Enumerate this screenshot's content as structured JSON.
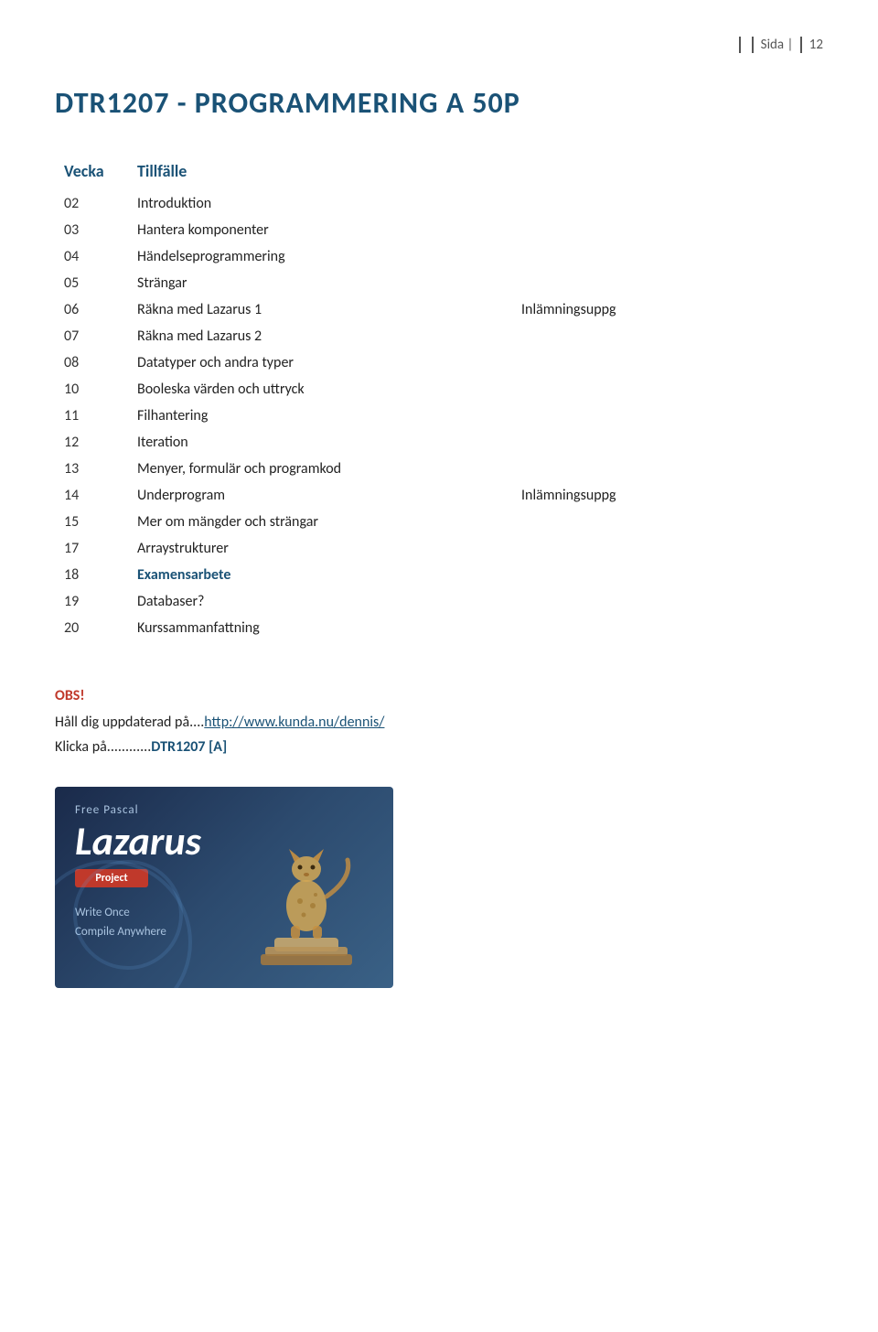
{
  "header": {
    "label": "Sida",
    "page_number": "12"
  },
  "title": "DTR1207 - PROGRAMMERING A 50P",
  "table": {
    "col_week": "Vecka",
    "col_event": "Tillfälle",
    "col_note": "",
    "rows": [
      {
        "week": "02",
        "event": "Introduktion",
        "note": "",
        "bold": false
      },
      {
        "week": "03",
        "event": "Hantera komponenter",
        "note": "",
        "bold": false
      },
      {
        "week": "04",
        "event": "Händelseprogrammering",
        "note": "",
        "bold": false
      },
      {
        "week": "05",
        "event": "Strängar",
        "note": "",
        "bold": false
      },
      {
        "week": "06",
        "event": "Räkna med Lazarus 1",
        "note": "Inlämningsuppg",
        "bold": false
      },
      {
        "week": "07",
        "event": "Räkna med Lazarus 2",
        "note": "",
        "bold": false
      },
      {
        "week": "08",
        "event": "Datatyper och andra typer",
        "note": "",
        "bold": false
      },
      {
        "week": "10",
        "event": "Booleska värden och uttryck",
        "note": "",
        "bold": false
      },
      {
        "week": "11",
        "event": "Filhantering",
        "note": "",
        "bold": false
      },
      {
        "week": "12",
        "event": "Iteration",
        "note": "",
        "bold": false
      },
      {
        "week": "13",
        "event": "Menyer, formulär och programkod",
        "note": "",
        "bold": false
      },
      {
        "week": "14",
        "event": "Underprogram",
        "note": "Inlämningsuppg",
        "bold": false
      },
      {
        "week": "15",
        "event": "Mer om mängder och strängar",
        "note": "",
        "bold": false
      },
      {
        "week": "17",
        "event": "Arraystrukturer",
        "note": "",
        "bold": false
      },
      {
        "week": "18",
        "event": "Examensarbete",
        "note": "",
        "bold": true
      },
      {
        "week": "19",
        "event": "Databaser?",
        "note": "",
        "bold": false
      },
      {
        "week": "20",
        "event": "Kurssammanfattning",
        "note": "",
        "bold": false
      }
    ]
  },
  "obs": {
    "title": "OBS!",
    "line1_before": "Håll dig uppdaterad på....",
    "line1_link_text": "http://www.kunda.nu/dennis/",
    "line1_link_href": "http://www.kunda.nu/dennis/",
    "line2_before": "Klicka på............",
    "line2_bold": "DTR1207 [A]"
  },
  "lazarus_image": {
    "free_pascal": "Free Pascal",
    "lazarus": "Lazarus",
    "project": "Project",
    "write_once": "Write Once",
    "compile_anywhere": "Compile Anywhere"
  }
}
